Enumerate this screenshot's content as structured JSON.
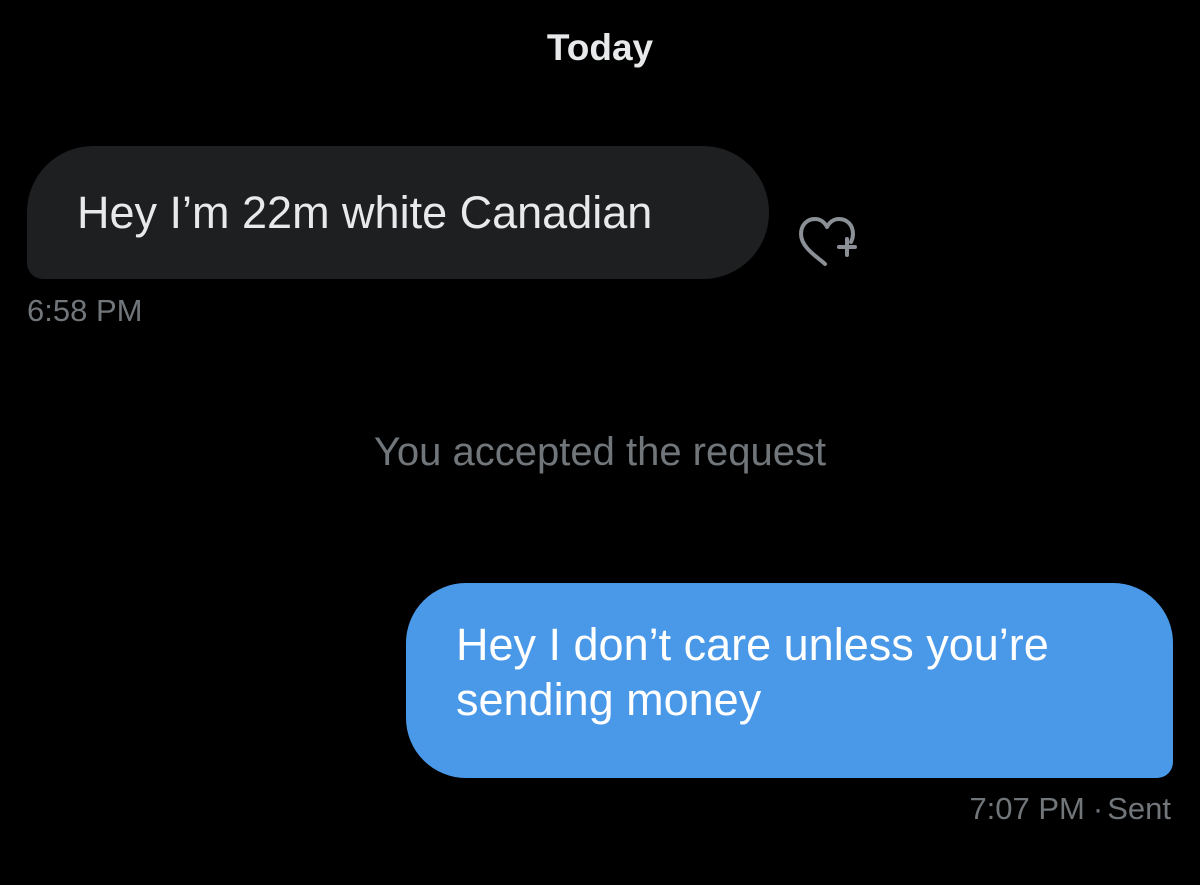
{
  "date_header": "Today",
  "incoming_message": {
    "text": "Hey I’m 22m white Canadian",
    "time": "6:58 PM",
    "react_icon": "heart-plus-icon"
  },
  "system_note": "You accepted the request",
  "outgoing_message": {
    "line1": "Hey I don’t care unless you’re",
    "line2": "sending money",
    "time": "7:07 PM",
    "separator": "·",
    "status": "Sent"
  },
  "colors": {
    "background": "#000000",
    "incoming_bubble": "#1e1f21",
    "outgoing_bubble": "#4a99e9",
    "primary_text": "#e7e9ea",
    "secondary_text": "#71767b"
  }
}
